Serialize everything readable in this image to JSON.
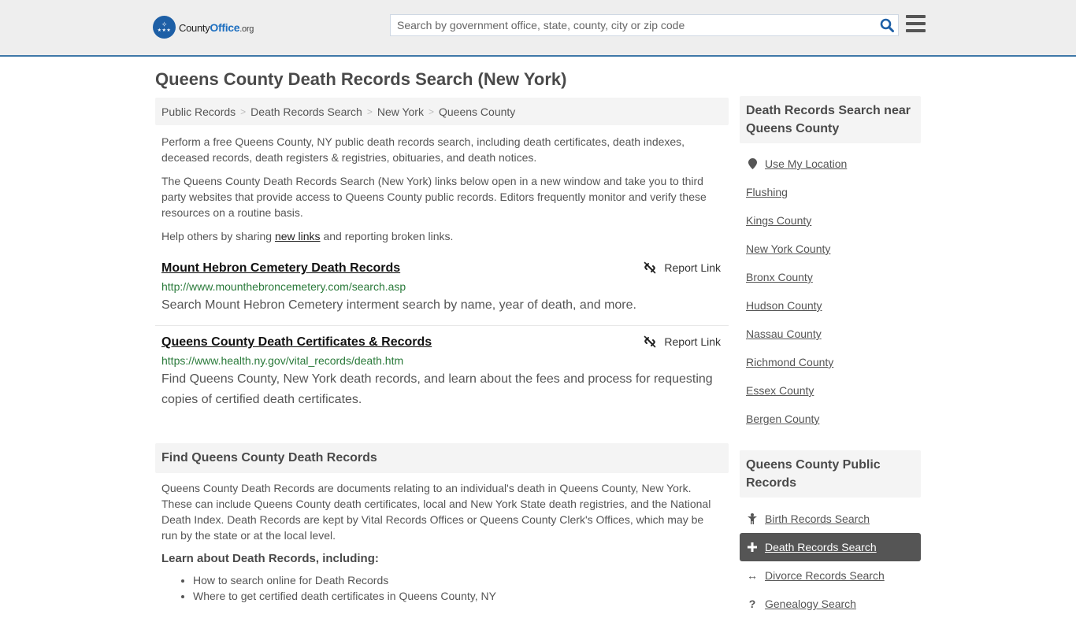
{
  "header": {
    "logo": {
      "brand_main": "County",
      "brand_accent": "Office",
      "brand_tld": ".org"
    },
    "search": {
      "placeholder": "Search by government office, state, county, city or zip code",
      "value": ""
    },
    "icons": {
      "search": "search-icon",
      "menu": "hamburger-menu-icon"
    },
    "colors": {
      "accent_border": "#3f78a8",
      "brand_blue": "#1d6fc0",
      "background": "#eeeeee"
    }
  },
  "page": {
    "title": "Queens County Death Records Search (New York)"
  },
  "breadcrumb": {
    "items": [
      "Public Records",
      "Death Records Search",
      "New York",
      "Queens County"
    ],
    "separator": ">"
  },
  "intro": {
    "p1": "Perform a free Queens County, NY public death records search, including death certificates, death indexes, deceased records, death registers & registries, obituaries, and death notices.",
    "p2": "The Queens County Death Records Search (New York) links below open in a new window and take you to third party websites that provide access to Queens County public records. Editors frequently monitor and verify these resources on a routine basis.",
    "p3_before": "Help others by sharing ",
    "p3_link": "new links",
    "p3_after": " and reporting broken links."
  },
  "results": [
    {
      "title": "Mount Hebron Cemetery Death Records",
      "url": "http://www.mounthebroncemetery.com/search.asp",
      "description": "Search Mount Hebron Cemetery interment search by name, year of death, and more.",
      "report_label": "Report Link"
    },
    {
      "title": "Queens County Death Certificates & Records",
      "url": "https://www.health.ny.gov/vital_records/death.htm",
      "description": "Find Queens County, New York death records, and learn about the fees and process for requesting copies of certified death certificates.",
      "report_label": "Report Link"
    }
  ],
  "find_section": {
    "heading": "Find Queens County Death Records",
    "body": "Queens County Death Records are documents relating to an individual's death in Queens County, New York. These can include Queens County death certificates, local and New York State death registries, and the National Death Index. Death Records are kept by Vital Records Offices or Queens County Clerk's Offices, which may be run by the state or at the local level.",
    "learn_heading": "Learn about Death Records, including:",
    "learn_items": [
      "How to search online for Death Records",
      "Where to get certified death certificates in Queens County, NY"
    ]
  },
  "sidebar_nearby": {
    "heading": "Death Records Search near Queens County",
    "use_location": "Use My Location",
    "items": [
      "Flushing",
      "Kings County",
      "New York County",
      "Bronx County",
      "Hudson County",
      "Nassau County",
      "Richmond County",
      "Essex County",
      "Bergen County"
    ]
  },
  "sidebar_public": {
    "heading": "Queens County Public Records",
    "items": [
      {
        "label": "Birth Records Search",
        "icon": "child-icon",
        "active": false
      },
      {
        "label": "Death Records Search",
        "icon": "plus-icon",
        "active": true
      },
      {
        "label": "Divorce Records Search",
        "icon": "left-right-arrow-icon",
        "active": false
      },
      {
        "label": "Genealogy Search",
        "icon": "question-icon",
        "active": false
      }
    ]
  }
}
